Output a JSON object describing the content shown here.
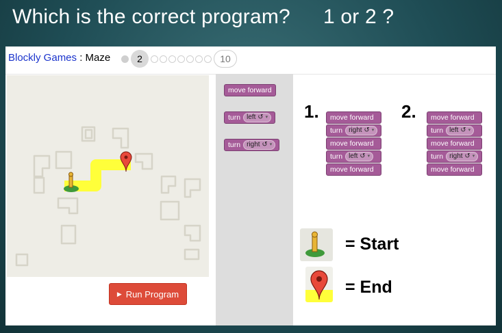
{
  "slide": {
    "question": "Which is the correct program?",
    "choice": "1 or 2 ?"
  },
  "header": {
    "app_link": "Blockly Games",
    "separator": " : ",
    "game_name": "Maze",
    "current_level": "2",
    "last_level": "10"
  },
  "run_button": {
    "label": "Run Program",
    "color": "#dd4b39"
  },
  "toolbox": {
    "move_forward": "move forward",
    "turn_left": {
      "word": "turn",
      "dir": "left ↺"
    },
    "turn_right": {
      "word": "turn",
      "dir": "right ↺"
    }
  },
  "programs": [
    {
      "number": "1.",
      "blocks": [
        {
          "word": "move forward",
          "dir": ""
        },
        {
          "word": "turn",
          "dir": "right ↺"
        },
        {
          "word": "move forward",
          "dir": ""
        },
        {
          "word": "turn",
          "dir": "left ↺"
        },
        {
          "word": "move forward",
          "dir": ""
        }
      ]
    },
    {
      "number": "2.",
      "blocks": [
        {
          "word": "move forward",
          "dir": ""
        },
        {
          "word": "turn",
          "dir": "left ↺"
        },
        {
          "word": "move forward",
          "dir": ""
        },
        {
          "word": "turn",
          "dir": "right ↺"
        },
        {
          "word": "move forward",
          "dir": ""
        }
      ]
    }
  ],
  "legend": {
    "start_label": "= Start",
    "end_label": "= End"
  },
  "colors": {
    "block": "#a55b98",
    "path": "#ffff00",
    "maze_bg": "#eeede6"
  }
}
